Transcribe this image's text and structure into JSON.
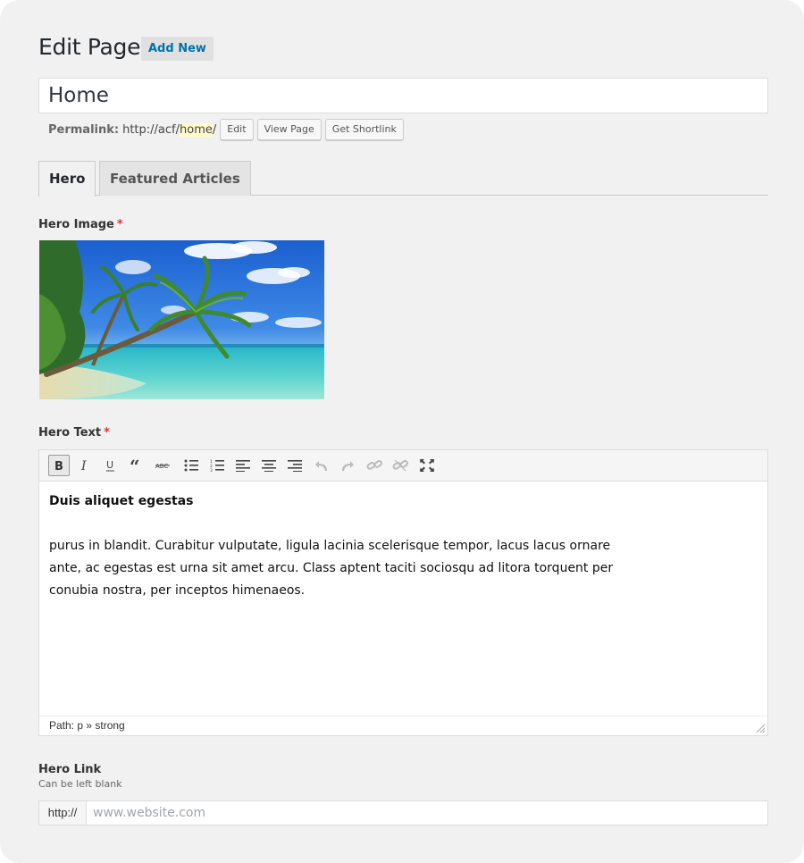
{
  "header": {
    "title": "Edit Page",
    "add_new_label": "Add New"
  },
  "post_title": {
    "value": "Home"
  },
  "permalink": {
    "label": "Permalink:",
    "base_url": "http://acf/",
    "slug": "home",
    "trailing": "/",
    "buttons": {
      "edit": "Edit",
      "view_page": "View Page",
      "get_shortlink": "Get Shortlink"
    }
  },
  "tabs": [
    {
      "label": "Hero",
      "active": true
    },
    {
      "label": "Featured Articles",
      "active": false
    }
  ],
  "fields": {
    "hero_image": {
      "label": "Hero Image",
      "required_mark": "*"
    },
    "hero_text": {
      "label": "Hero Text",
      "required_mark": "*",
      "toolbar": [
        "bold-icon",
        "italic-icon",
        "underline-icon",
        "blockquote-icon",
        "strikethrough-icon",
        "bullet-list-icon",
        "numbered-list-icon",
        "align-left-icon",
        "align-center-icon",
        "align-right-icon",
        "undo-icon",
        "redo-icon",
        "link-icon",
        "unlink-icon",
        "fullscreen-icon"
      ],
      "content_heading": "Duis aliquet egestas",
      "content_paragraph": "purus in blandit. Curabitur vulputate, ligula lacinia scelerisque tempor, lacus lacus ornare\nante, ac egestas est urna sit amet arcu. Class aptent taciti sociosqu ad litora torquent per\nconubia nostra, per inceptos himenaeos.",
      "status_path": "Path: p » strong"
    },
    "hero_link": {
      "label": "Hero Link",
      "description": "Can be left blank",
      "prefix": "http://",
      "placeholder": "www.website.com",
      "value": ""
    }
  },
  "colors": {
    "background": "#f1f1f1",
    "link_blue": "#0073aa",
    "required_red": "#dd3333",
    "slug_highlight": "#fffbcc"
  }
}
